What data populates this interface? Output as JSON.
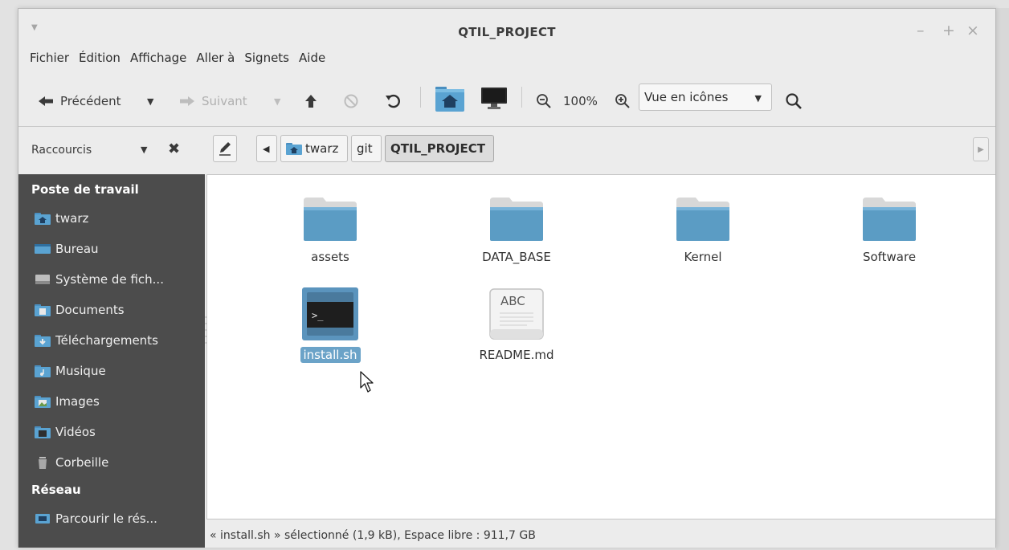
{
  "window": {
    "title": "QTIL_PROJECT",
    "controls": {
      "minimize": "–",
      "maximize": "+",
      "close": "×"
    }
  },
  "menu": [
    "Fichier",
    "Édition",
    "Affichage",
    "Aller à",
    "Signets",
    "Aide"
  ],
  "toolbar": {
    "back_label": "Précédent",
    "forward_label": "Suivant",
    "zoom_level": "100%",
    "view_mode": "Vue en icônes"
  },
  "sidebar_header": "Raccourcis",
  "breadcrumb": [
    "twarz",
    "git",
    "QTIL_PROJECT"
  ],
  "sidebar": {
    "section1": "Poste de travail",
    "items": [
      "twarz",
      "Bureau",
      "Système de fich...",
      "Documents",
      "Téléchargements",
      "Musique",
      "Images",
      "Vidéos",
      "Corbeille"
    ],
    "section2": "Réseau",
    "network_items": [
      "Parcourir le rés..."
    ]
  },
  "files": [
    {
      "name": "assets",
      "kind": "folder"
    },
    {
      "name": "DATA_BASE",
      "kind": "folder"
    },
    {
      "name": "Kernel",
      "kind": "folder"
    },
    {
      "name": "Software",
      "kind": "folder"
    },
    {
      "name": "install.sh",
      "kind": "script",
      "selected": true
    },
    {
      "name": "README.md",
      "kind": "text",
      "preview": "ABC"
    }
  ],
  "status": "« install.sh » sélectionné (1,9 kB), Espace libre : 911,7 GB",
  "colors": {
    "sidebar_bg": "#4c4c4c",
    "selection": "#6ba3c8",
    "folder": "#5b9cc4"
  }
}
